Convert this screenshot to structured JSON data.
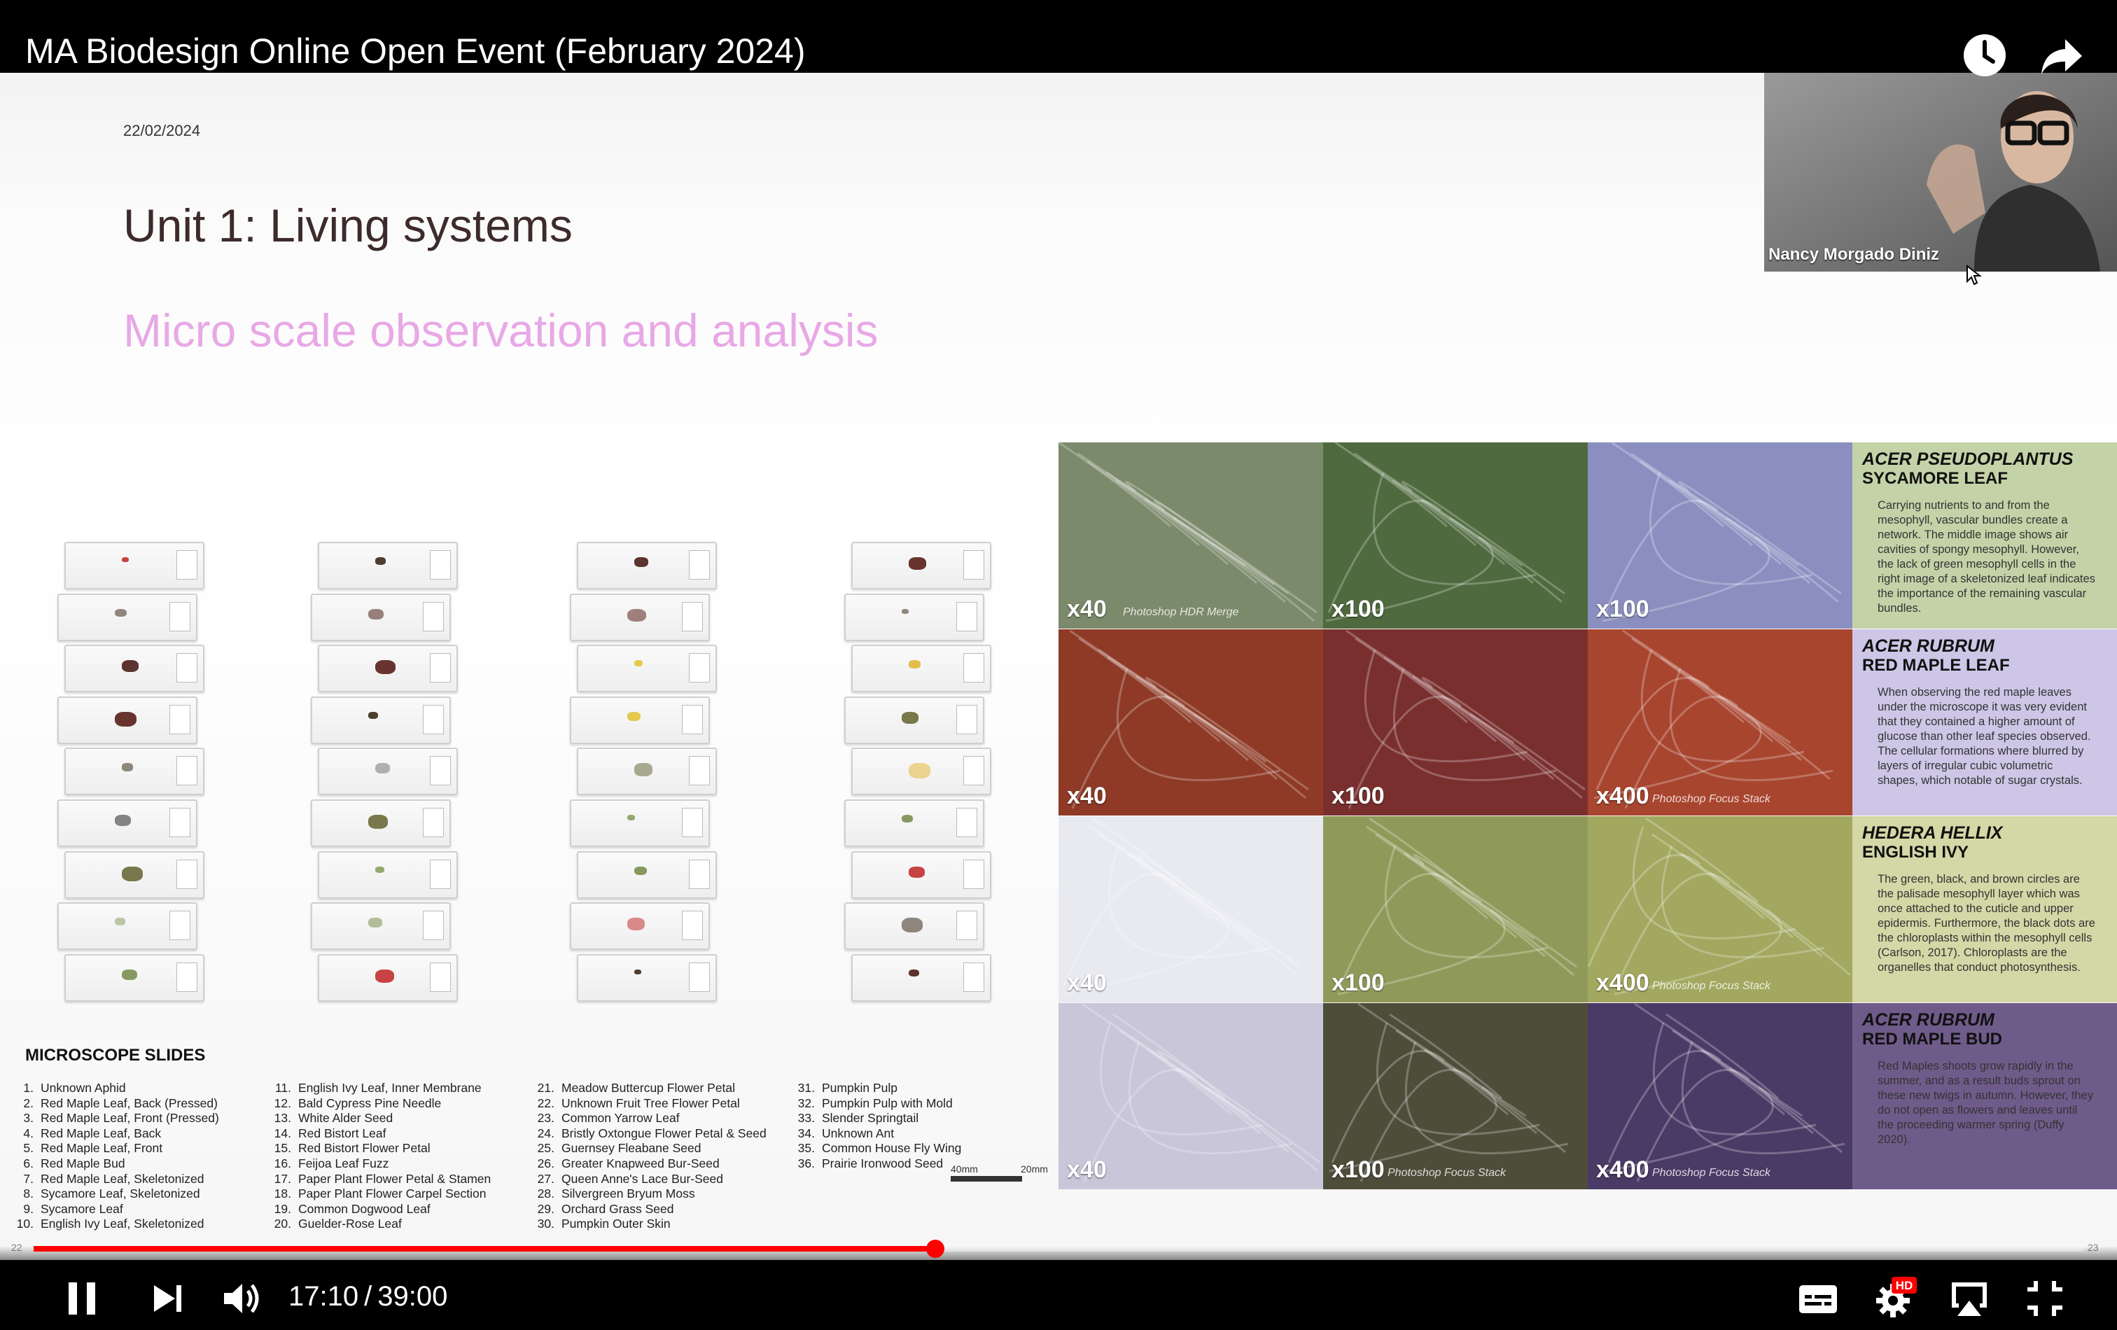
{
  "video": {
    "title": "MA Biodesign Online Open Event (February 2024)",
    "icons": {
      "watch_later": "clock-icon",
      "share": "share-arrow-icon"
    }
  },
  "slide": {
    "date": "22/02/2024",
    "title": "Unit 1: Living systems",
    "subtitle": "Micro scale observation and analysis",
    "subtitle_color": "#e8a8e6",
    "page_left": "22",
    "page_right": "23",
    "slides_heading": "MICROSCOPE SLIDES",
    "slide_columns": [
      [
        {
          "num": "1.",
          "name": "Unknown Aphid"
        },
        {
          "num": "2.",
          "name": "Red Maple Leaf, Back (Pressed)"
        },
        {
          "num": "3.",
          "name": "Red Maple Leaf, Front (Pressed)"
        },
        {
          "num": "4.",
          "name": "Red Maple Leaf, Back"
        },
        {
          "num": "5.",
          "name": "Red Maple Leaf, Front"
        },
        {
          "num": "6.",
          "name": "Red Maple Bud"
        },
        {
          "num": "7.",
          "name": "Red Maple Leaf, Skeletonized"
        },
        {
          "num": "8.",
          "name": "Sycamore Leaf, Skeletonized"
        },
        {
          "num": "9.",
          "name": "Sycamore Leaf"
        },
        {
          "num": "10.",
          "name": "English Ivy Leaf, Skeletonized"
        }
      ],
      [
        {
          "num": "11.",
          "name": "English Ivy Leaf, Inner Membrane"
        },
        {
          "num": "12.",
          "name": "Bald Cypress Pine Needle"
        },
        {
          "num": "13.",
          "name": "White Alder Seed"
        },
        {
          "num": "14.",
          "name": "Red Bistort Leaf"
        },
        {
          "num": "15.",
          "name": "Red Bistort Flower Petal"
        },
        {
          "num": "16.",
          "name": "Feijoa Leaf Fuzz"
        },
        {
          "num": "17.",
          "name": "Paper Plant Flower Petal & Stamen"
        },
        {
          "num": "18.",
          "name": "Paper Plant Flower Carpel Section"
        },
        {
          "num": "19.",
          "name": "Common Dogwood Leaf"
        },
        {
          "num": "20.",
          "name": "Guelder-Rose Leaf"
        }
      ],
      [
        {
          "num": "21.",
          "name": "Meadow Buttercup Flower Petal"
        },
        {
          "num": "22.",
          "name": "Unknown Fruit Tree Flower Petal"
        },
        {
          "num": "23.",
          "name": "Common Yarrow Leaf"
        },
        {
          "num": "24.",
          "name": "Bristly Oxtongue Flower Petal & Seed"
        },
        {
          "num": "25.",
          "name": "Guernsey Fleabane Seed"
        },
        {
          "num": "26.",
          "name": "Greater Knapweed Bur-Seed"
        },
        {
          "num": "27.",
          "name": "Queen Anne's Lace Bur-Seed"
        },
        {
          "num": "28.",
          "name": "Silvergreen Bryum Moss"
        },
        {
          "num": "29.",
          "name": "Orchard Grass Seed"
        },
        {
          "num": "30.",
          "name": "Pumpkin Outer Skin"
        }
      ],
      [
        {
          "num": "31.",
          "name": "Pumpkin Pulp"
        },
        {
          "num": "32.",
          "name": "Pumpkin Pulp with Mold"
        },
        {
          "num": "33.",
          "name": "Slender Springtail"
        },
        {
          "num": "34.",
          "name": "Unknown Ant"
        },
        {
          "num": "35.",
          "name": "Common House Fly Wing"
        },
        {
          "num": "36.",
          "name": "Prairie Ironwood Seed"
        }
      ]
    ],
    "scale_labels": [
      "40mm",
      "20mm"
    ],
    "specimens": [
      {
        "species": "ACER PSEUDOPLANTUS",
        "common": "SYCAMORE LEAF",
        "description": "Carrying nutrients to and from the mesophyll, vascular bundles create a network. The middle image shows air cavities of spongy mesophyll. However, the lack of green mesophyll cells in the right image of a skeletonized leaf indicates the importance of the remaining vascular bundles.",
        "panel_color": "#c4d2a8",
        "images": [
          {
            "mag": "x40",
            "note": "Photoshop HDR Merge",
            "bg": "#7a8a6a"
          },
          {
            "mag": "x100",
            "note": "",
            "bg": "#4f6a3e"
          },
          {
            "mag": "x100",
            "note": "",
            "bg": "#8a8fc0"
          }
        ]
      },
      {
        "species": "ACER RUBRUM",
        "common": "RED MAPLE LEAF",
        "description": "When observing the red maple leaves under the microscope it was very evident that they contained a higher amount of glucose than other leaf species observed. The cellular formations where blurred by layers of irregular cubic volumetric shapes, which notable of sugar crystals.",
        "panel_color": "#cdc6e6",
        "images": [
          {
            "mag": "x40",
            "note": "",
            "bg": "#8e3a26"
          },
          {
            "mag": "x100",
            "note": "",
            "bg": "#7a2f2f"
          },
          {
            "mag": "x400",
            "note": "Photoshop Focus Stack",
            "bg": "#a8452f"
          }
        ]
      },
      {
        "species": "HEDERA HELLIX",
        "common": "ENGLISH IVY",
        "description": "The green, black, and brown circles are the palisade mesophyll layer which was once attached to the cuticle and upper epidermis. Furthermore, the black dots are the chloroplasts within the mesophyll cells (Carlson, 2017). Chloroplasts are the organelles that conduct photosynthesis.",
        "panel_color": "#d3d8a6",
        "images": [
          {
            "mag": "x40",
            "note": "",
            "bg": "#e9eaf0"
          },
          {
            "mag": "x100",
            "note": "",
            "bg": "#8f9a5a"
          },
          {
            "mag": "x400",
            "note": "Photoshop Focus Stack",
            "bg": "#a2a860"
          }
        ]
      },
      {
        "species": "ACER RUBRUM",
        "common": "RED MAPLE BUD",
        "description": "Red Maples shoots grow rapidly in the summer, and as a result buds sprout on these new twigs in autumn. However, they do not open as flowers and leaves until the proceeding warmer spring (Duffy 2020).",
        "panel_color": "#6f5b8a",
        "images": [
          {
            "mag": "x40",
            "note": "",
            "bg": "#c8c6d8"
          },
          {
            "mag": "x100",
            "note": "Photoshop Focus Stack",
            "bg": "#4e4d3a"
          },
          {
            "mag": "x400",
            "note": "Photoshop Focus Stack",
            "bg": "#4a3a66"
          }
        ]
      }
    ]
  },
  "webcam": {
    "name": "Nancy Morgado Diniz"
  },
  "controls": {
    "current_time": "17:10",
    "separator": "/",
    "duration": "39:00",
    "progress_fraction": 0.44,
    "accent_color": "#ff0000",
    "hd_badge": "HD",
    "icons": [
      "pause-icon",
      "next-icon",
      "volume-icon",
      "subtitles-icon",
      "settings-icon",
      "airplay-icon",
      "exit-fullscreen-icon"
    ]
  }
}
